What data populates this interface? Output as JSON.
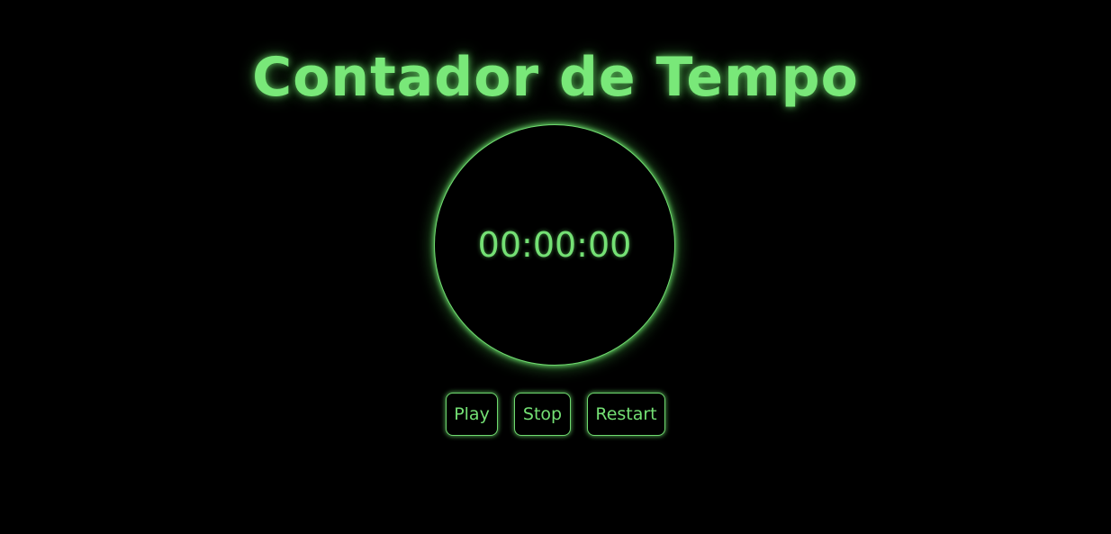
{
  "header": {
    "title": "Contador de Tempo"
  },
  "timer": {
    "display": "00:00:00"
  },
  "controls": {
    "play_label": "Play",
    "stop_label": "Stop",
    "restart_label": "Restart"
  },
  "colors": {
    "background": "#000000",
    "accent": "#6fe46f"
  }
}
